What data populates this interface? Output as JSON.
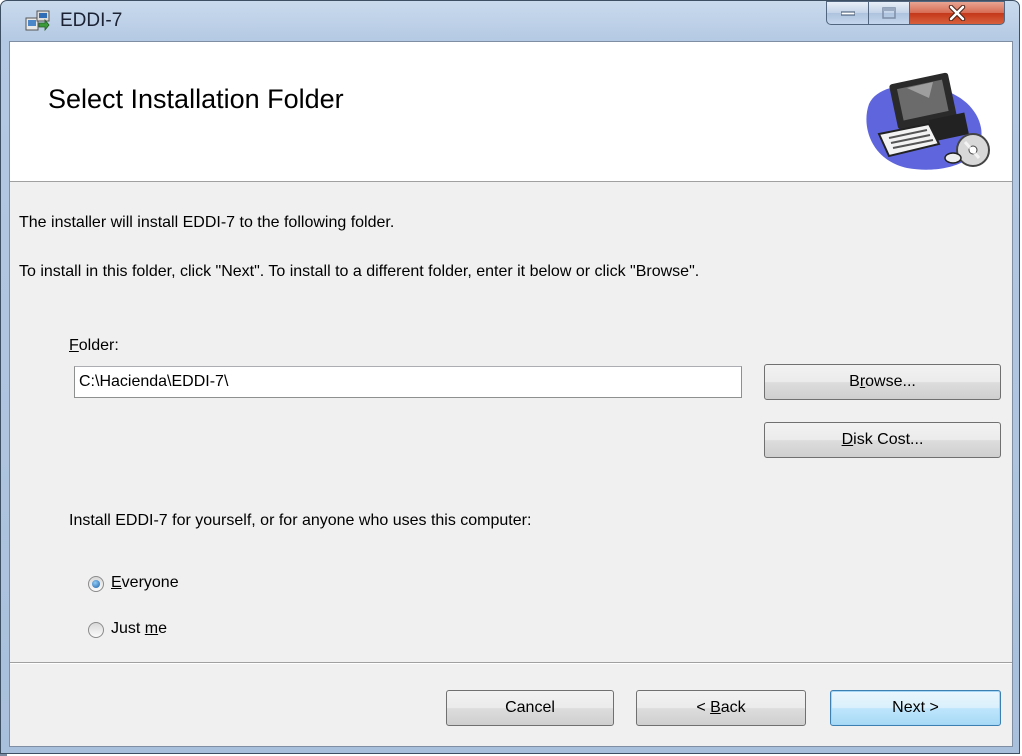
{
  "window": {
    "title": "EDDI-7",
    "controls": [
      "minimize-icon",
      "maximize-icon",
      "close-icon"
    ]
  },
  "banner": {
    "title": "Select Installation Folder",
    "art": "computer-install-graphic"
  },
  "body": {
    "line1": "The installer will install EDDI-7 to the following folder.",
    "line2": "To install in this folder, click \"Next\". To install to a different folder, enter it below or click \"Browse\".",
    "folder_label_mnemonic": "F",
    "folder_label_rest": "older:",
    "folder_value": "C:\\Hacienda\\EDDI-7\\",
    "browse_pre": "B",
    "browse_mnemonic": "r",
    "browse_post": "owse...",
    "diskcost_mnemonic": "D",
    "diskcost_rest": "isk Cost...",
    "install_for": "Install EDDI-7 for yourself, or for anyone who uses this computer:",
    "radio_everyone_mnemonic": "E",
    "radio_everyone_rest": "veryone",
    "radio_justme_pre": "Just ",
    "radio_justme_mnemonic": "m",
    "radio_justme_post": "e",
    "selected_option": "Everyone"
  },
  "footer": {
    "cancel": "Cancel",
    "back_pre": "< ",
    "back_mnemonic": "B",
    "back_post": "ack",
    "next": "Next >"
  }
}
